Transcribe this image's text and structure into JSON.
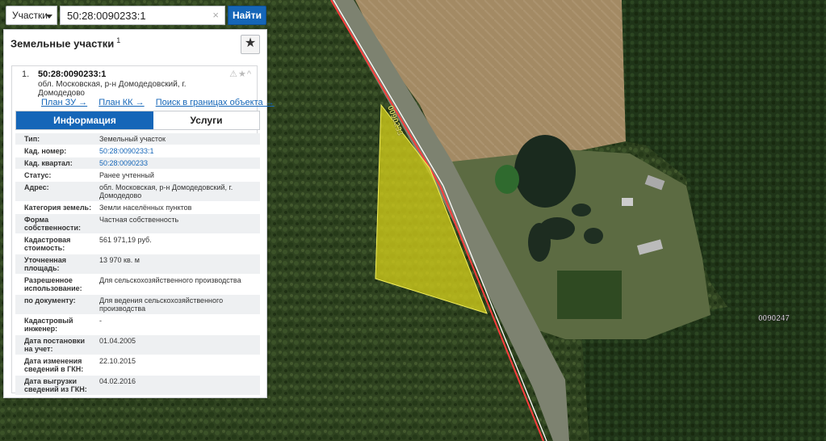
{
  "search": {
    "layer_label": "Участки",
    "query": "50:28:0090233:1",
    "clear_icon": "×",
    "button_label": "Найти"
  },
  "panel": {
    "title": "Земельные участки",
    "count": "1",
    "fav_icon": "★"
  },
  "result": {
    "index": "1.",
    "cad_number": "50:28:0090233:1",
    "address": "обл. Московская, р-н Домодедовский, г. Домодедово",
    "icons": "⚠★^",
    "links": [
      "План ЗУ →",
      "План КК →",
      "Поиск в границах объекта →"
    ]
  },
  "tabs": [
    "Информация",
    "Услуги"
  ],
  "details": [
    {
      "key": "Тип:",
      "value": "Земельный участок"
    },
    {
      "key": "Кад. номер:",
      "value": "50:28:0090233:1"
    },
    {
      "key": "Кад. квартал:",
      "value": "50:28:0090233"
    },
    {
      "key": "Статус:",
      "value": "Ранее учтенный"
    },
    {
      "key": "Адрес:",
      "value": "обл. Московская, р-н Домодедовский, г. Домодедово"
    },
    {
      "key": "Категория земель:",
      "value": "Земли населённых пунктов"
    },
    {
      "key": "Форма собственности:",
      "value": "Частная собственность"
    },
    {
      "key": "Кадастровая стоимость:",
      "value": "561 971,19 руб."
    },
    {
      "key": "Уточненная площадь:",
      "value": "13 970 кв. м"
    },
    {
      "key": "Разрешенное использование:",
      "value": "Для сельскохозяйственного производства"
    },
    {
      "key": "по документу:",
      "value": "Для ведения сельскохозяйственного производства"
    },
    {
      "key": "Кадастровый инженер:",
      "value": "-"
    },
    {
      "key": "Дата постановки на учет:",
      "value": "01.04.2005"
    },
    {
      "key": "Дата изменения сведений в ГКН:",
      "value": "22.10.2015"
    },
    {
      "key": "Дата выгрузки сведений из ГКН:",
      "value": "04.02.2016"
    }
  ],
  "map": {
    "parcel_label": "0090233",
    "block_label": "0090247",
    "parcel_color": "#d8d21a",
    "road_border_color": "#ff3c3c"
  }
}
